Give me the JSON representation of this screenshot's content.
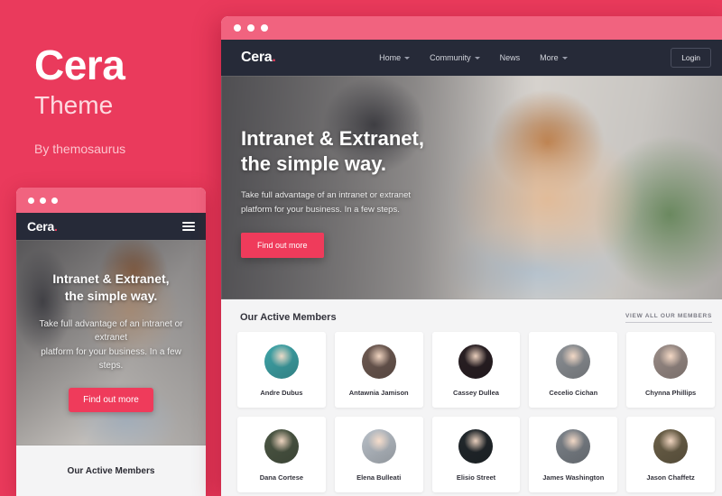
{
  "promo": {
    "background_color": "#ea3a5c",
    "brand_name": "Cera",
    "brand_subtitle": "Theme",
    "brand_byline": "By themosaurus"
  },
  "accent_color": "#ef3b5b",
  "navbar_color": "#262a38",
  "titlebar_color": "#f1637f",
  "mobile_mockup": {
    "titlebar": {
      "dots": 3
    },
    "nav": {
      "logo_text": "Cera",
      "logo_dot": ".",
      "menu_icon": "hamburger-icon"
    },
    "hero": {
      "heading_line1": "Intranet & Extranet,",
      "heading_line2": "the simple way.",
      "paragraph_line1": "Take full advantage of an intranet or extranet",
      "paragraph_line2": "platform for your business. In a few steps.",
      "cta_label": "Find out more"
    },
    "members_title": "Our Active Members"
  },
  "desktop_mockup": {
    "titlebar": {
      "dots": 3
    },
    "nav": {
      "logo_text": "Cera",
      "logo_dot": ".",
      "links": [
        {
          "label": "Home",
          "has_caret": true
        },
        {
          "label": "Community",
          "has_caret": true
        },
        {
          "label": "News",
          "has_caret": false
        },
        {
          "label": "More",
          "has_caret": true
        }
      ],
      "login_label": "Login"
    },
    "hero": {
      "heading_line1": "Intranet & Extranet,",
      "heading_line2": "the simple way.",
      "paragraph_line1": "Take full advantage of an intranet or extranet",
      "paragraph_line2": "platform for your business. In a few steps.",
      "cta_label": "Find out more"
    },
    "members": {
      "section_title": "Our Active Members",
      "view_all_label": "VIEW ALL OUR MEMBERS",
      "cards": [
        {
          "name": "Andre Dubus",
          "avatar_tint": "#3fa4a8"
        },
        {
          "name": "Antawnia Jamison",
          "avatar_tint": "#6e5a52"
        },
        {
          "name": "Cassey Dullea",
          "avatar_tint": "#2a2024"
        },
        {
          "name": "Cecelio Cichan",
          "avatar_tint": "#8d9196"
        },
        {
          "name": "Chynna Phillips",
          "avatar_tint": "#9b8d88"
        },
        {
          "name": "Dana Cortese",
          "avatar_tint": "#4c5744"
        },
        {
          "name": "Elena Bulleati",
          "avatar_tint": "#b9c0c8"
        },
        {
          "name": "Elisio Street",
          "avatar_tint": "#22282c"
        },
        {
          "name": "James Washington",
          "avatar_tint": "#7d838a"
        },
        {
          "name": "Jason Chaffetz",
          "avatar_tint": "#6b6048"
        }
      ]
    }
  }
}
